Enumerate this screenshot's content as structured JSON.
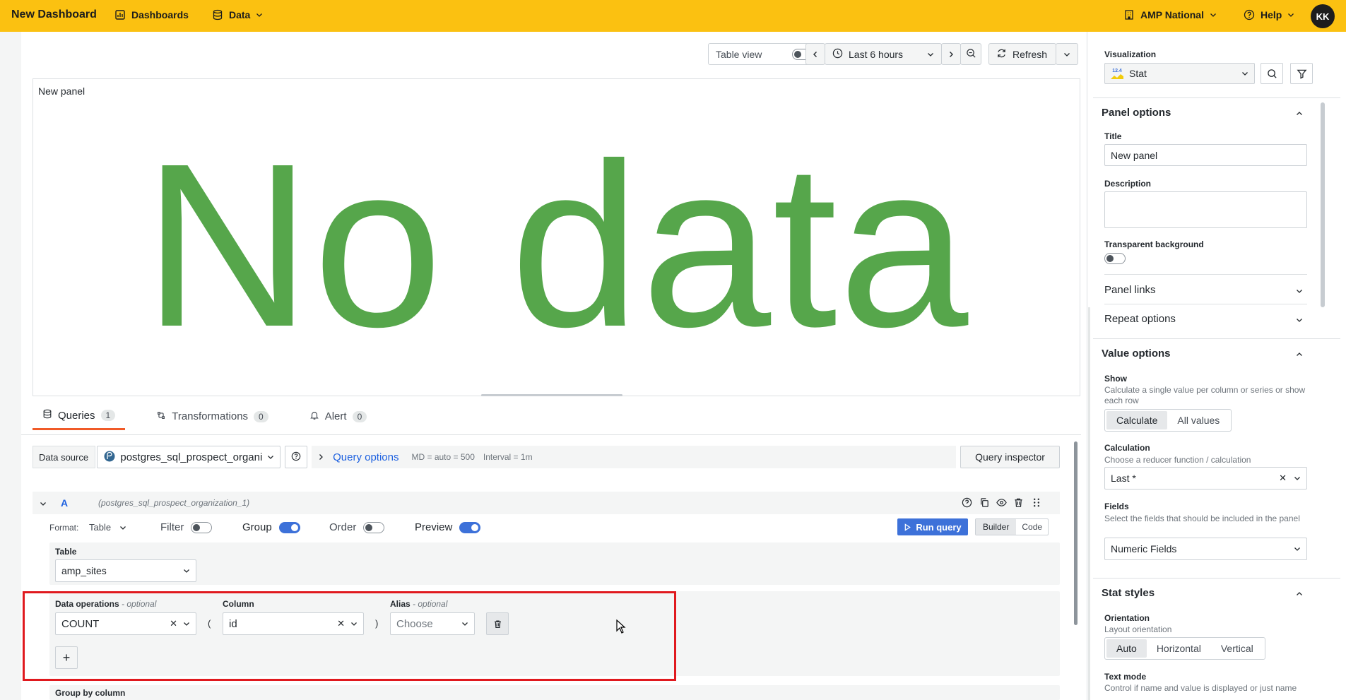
{
  "topbar": {
    "title": "New Dashboard",
    "nav_dashboards": "Dashboards",
    "nav_data": "Data",
    "org": "AMP National",
    "help": "Help",
    "avatar": "KK",
    "bg_color": "#fbc111"
  },
  "toolbar": {
    "table_view": "Table view",
    "time_range": "Last 6 hours",
    "refresh": "Refresh"
  },
  "panel": {
    "title": "New panel",
    "no_data": "No data",
    "value_color": "#56a64b"
  },
  "tabs": [
    {
      "label": "Queries",
      "count": "1"
    },
    {
      "label": "Transformations",
      "count": "0"
    },
    {
      "label": "Alert",
      "count": "0"
    }
  ],
  "datasource": {
    "label": "Data source",
    "value": "postgres_sql_prospect_organi:",
    "query_options": "Query options",
    "md": "MD = auto = 500",
    "interval": "Interval = 1m",
    "inspector": "Query inspector"
  },
  "query": {
    "ref": "A",
    "source": "(postgres_sql_prospect_organization_1)",
    "format_label": "Format:",
    "format_value": "Table",
    "filter": "Filter",
    "group": "Group",
    "order": "Order",
    "preview": "Preview",
    "run": "Run query",
    "builder": "Builder",
    "code": "Code",
    "table_label": "Table",
    "table_value": "amp_sites",
    "dataops_label": "Data operations",
    "optional": "- optional",
    "column_label": "Column",
    "alias_label": "Alias",
    "op_value": "COUNT",
    "paren_open": "(",
    "column_value": "id",
    "paren_close": ")",
    "alias_placeholder": "Choose",
    "add": "+",
    "group_by": "Group by column"
  },
  "sidebar": {
    "viz_label": "Visualization",
    "viz_value": "Stat",
    "viz_icon_text": "12.4",
    "panel_options": "Panel options",
    "title_label": "Title",
    "title_value": "New panel",
    "desc_label": "Description",
    "transparent_label": "Transparent background",
    "panel_links": "Panel links",
    "repeat_options": "Repeat options",
    "value_options": "Value options",
    "show_label": "Show",
    "show_desc": "Calculate a single value per column or series or show each row",
    "show_opts": [
      "Calculate",
      "All values"
    ],
    "calc_label": "Calculation",
    "calc_desc": "Choose a reducer function / calculation",
    "calc_value": "Last *",
    "fields_label": "Fields",
    "fields_desc": "Select the fields that should be included in the panel",
    "fields_value": "Numeric Fields",
    "stat_styles": "Stat styles",
    "orient_label": "Orientation",
    "orient_desc": "Layout orientation",
    "orient_opts": [
      "Auto",
      "Horizontal",
      "Vertical"
    ],
    "text_mode_label": "Text mode",
    "text_mode_desc": "Control if name and value is displayed or just name"
  }
}
